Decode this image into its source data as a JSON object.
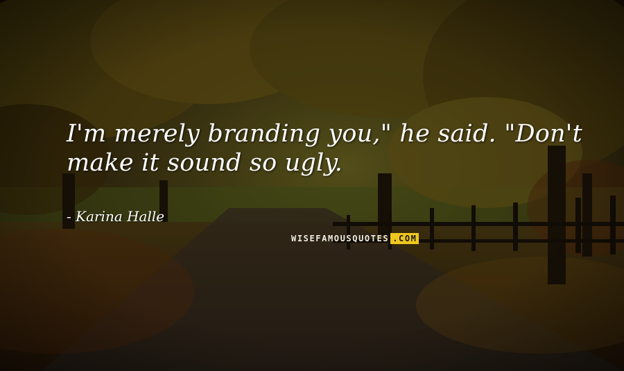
{
  "quote": {
    "text": "I'm merely branding you,\" he said. \"Don't make it sound so ugly."
  },
  "author": {
    "name": "Karina Halle"
  },
  "watermark": {
    "main": "WISEFAMOUSQUOTES",
    "tld": ".COM",
    "accent_color": "#f0c81e"
  },
  "scene": {
    "description_colors": {
      "foliage": "#6b5a14",
      "sky": "#3a3a18",
      "path": "#3a2a12",
      "fence": "#1a120a"
    }
  }
}
